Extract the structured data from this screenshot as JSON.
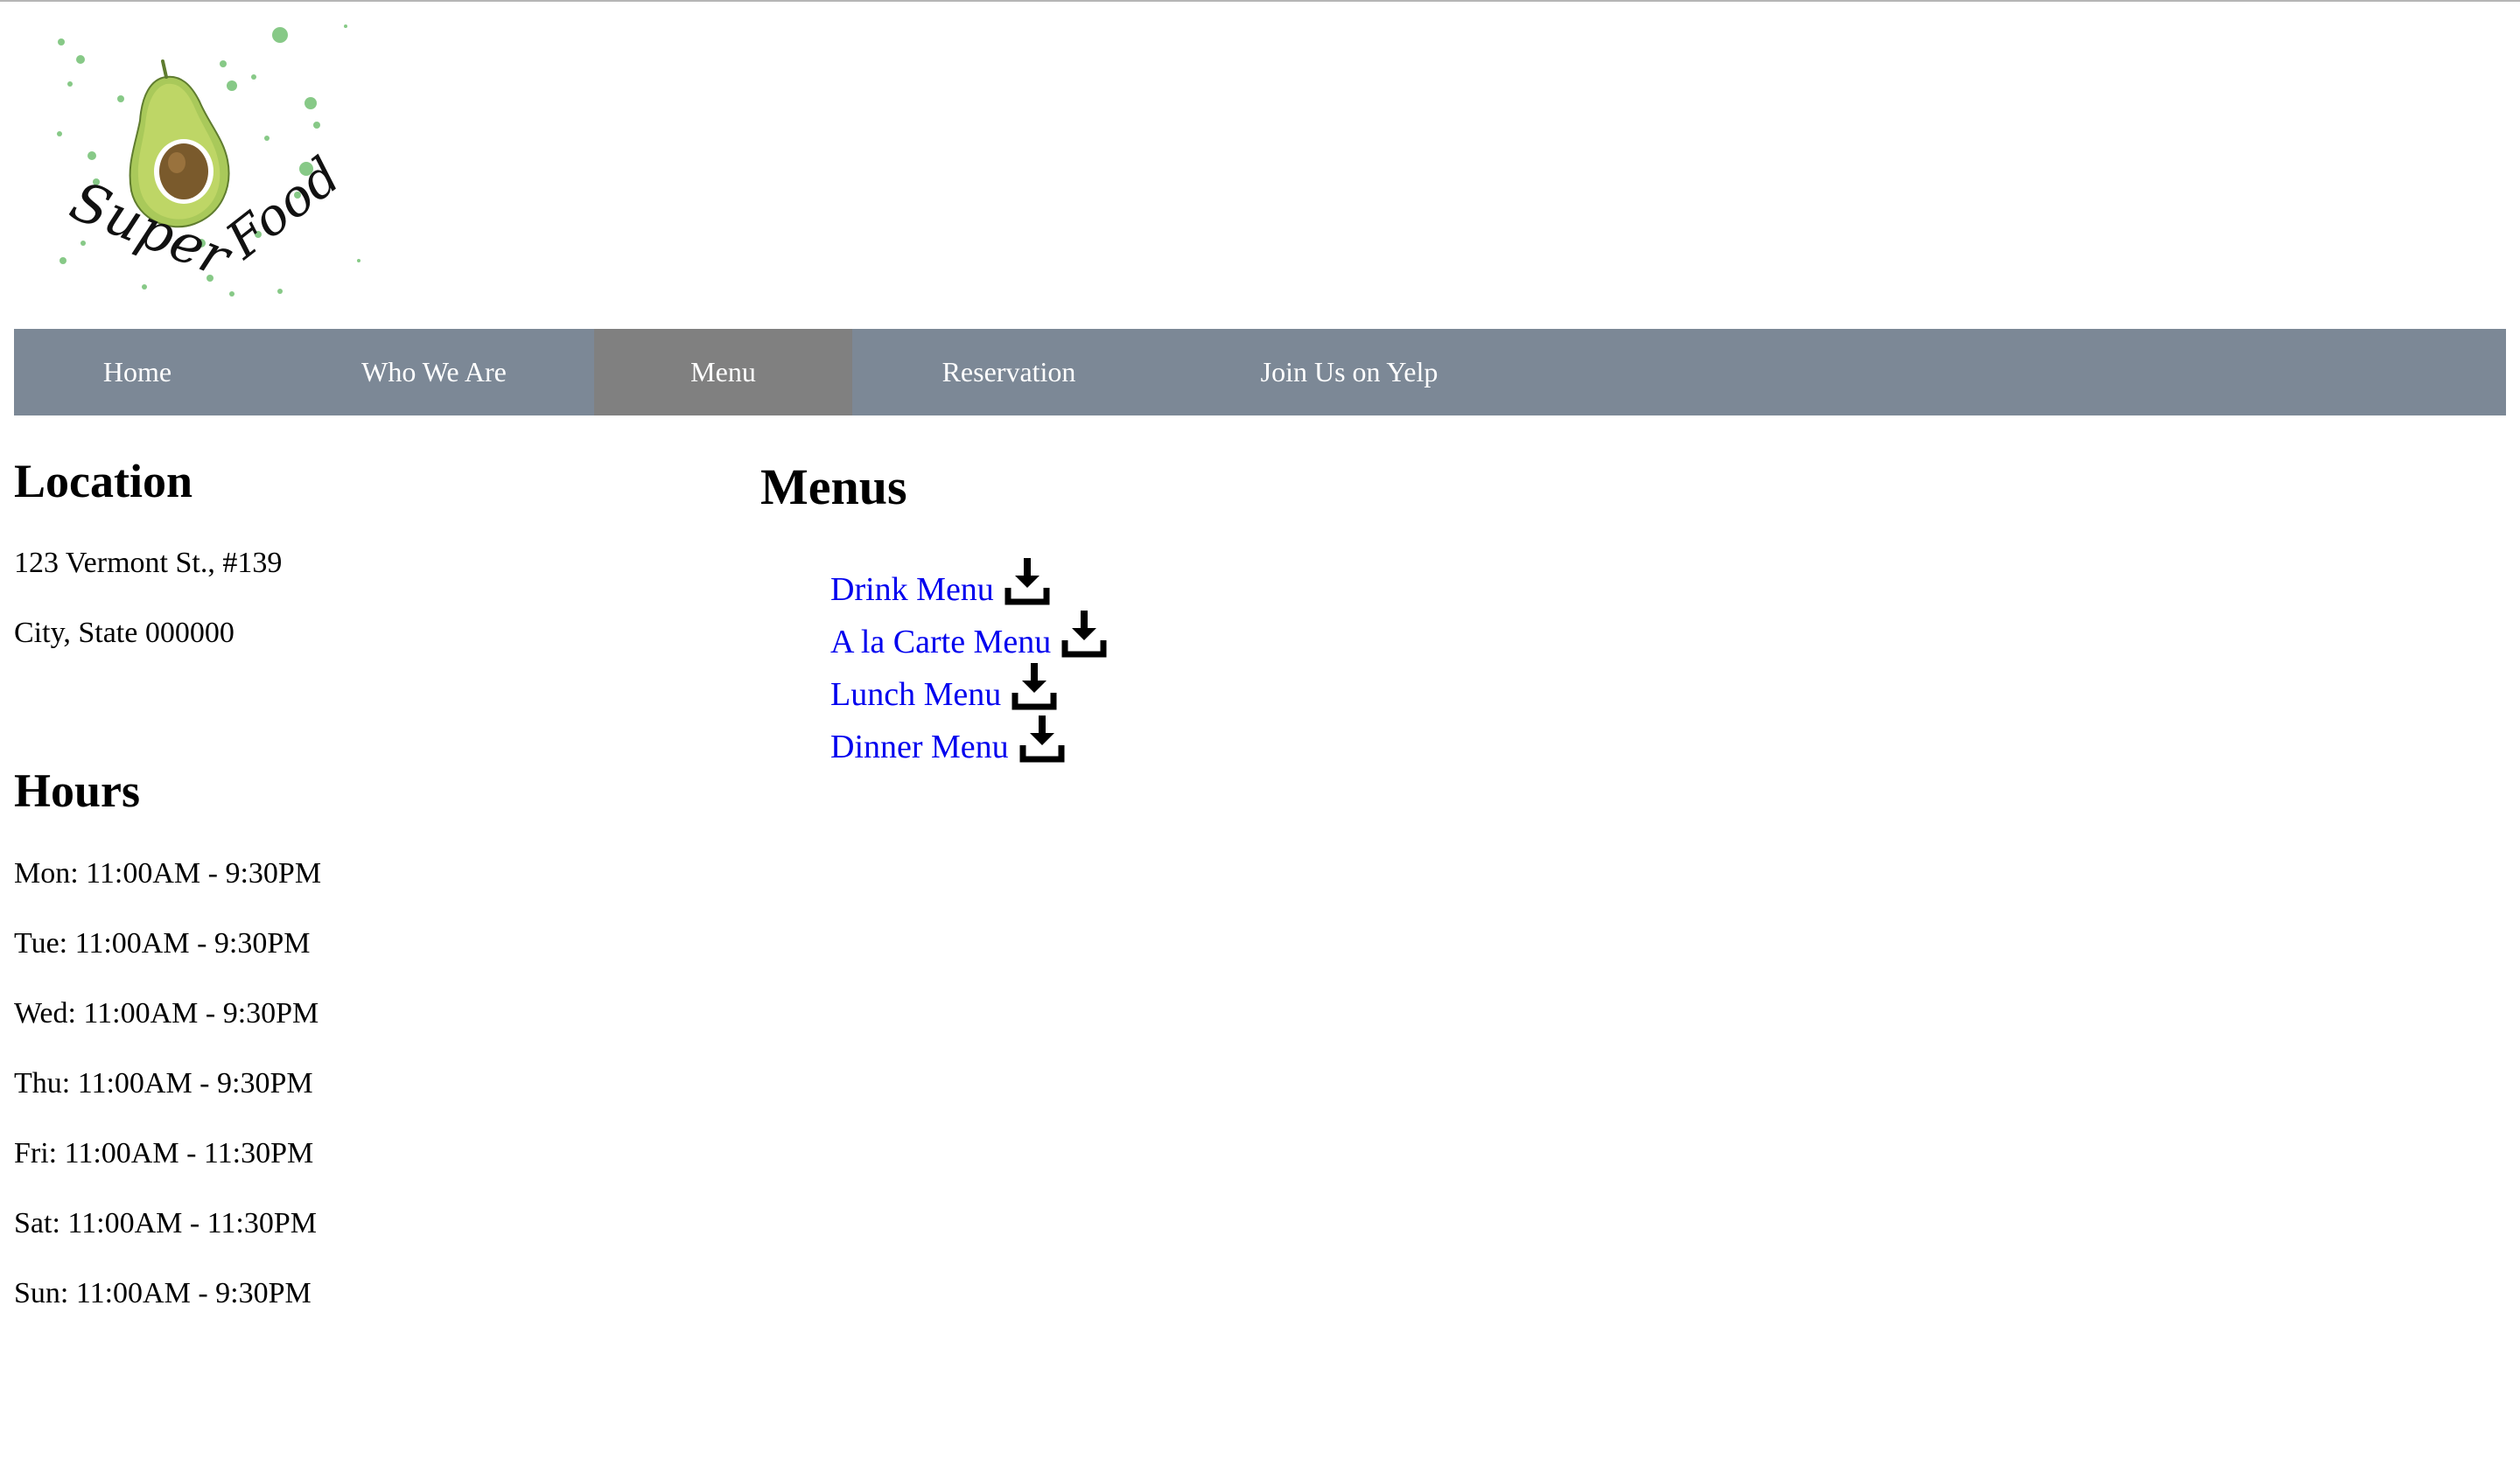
{
  "header": {
    "logo_text": "Super Food",
    "logo_icon": "avocado-icon"
  },
  "nav": {
    "items": [
      {
        "label": "Home"
      },
      {
        "label": "Who We Are"
      },
      {
        "label": "Menu"
      },
      {
        "label": "Reservation"
      },
      {
        "label": "Join Us on Yelp"
      }
    ],
    "active": "Menu",
    "bar_color": "#7c8896",
    "active_color": "#808080"
  },
  "location": {
    "heading": "Location",
    "address_line1": "123 Vermont St., #139",
    "address_line2": "City, State 000000"
  },
  "hours": {
    "heading": "Hours",
    "days": [
      "Mon: 11:00AM - 9:30PM",
      "Tue: 11:00AM - 9:30PM",
      "Wed: 11:00AM - 9:30PM",
      "Thu: 11:00AM - 9:30PM",
      "Fri: 11:00AM - 11:30PM",
      "Sat: 11:00AM - 11:30PM",
      "Sun: 11:00AM - 9:30PM"
    ]
  },
  "menus": {
    "heading": "Menus",
    "items": [
      {
        "label": "Drink Menu",
        "icon": "download-icon"
      },
      {
        "label": "A la Carte Menu",
        "icon": "download-icon"
      },
      {
        "label": "Lunch Menu",
        "icon": "download-icon"
      },
      {
        "label": "Dinner Menu",
        "icon": "download-icon"
      }
    ],
    "link_color": "#0000ee"
  }
}
